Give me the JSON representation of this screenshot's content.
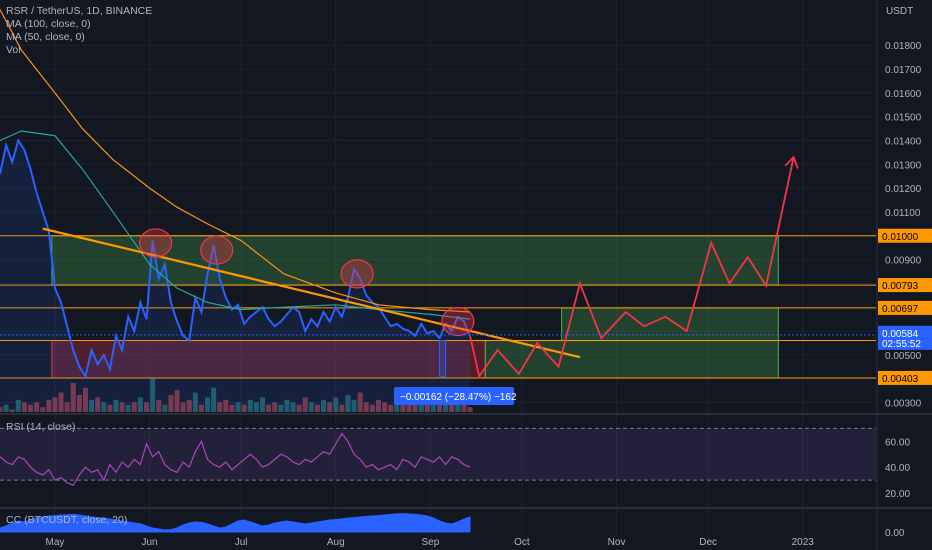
{
  "legend": {
    "title": "RSR / TetherUS, 1D, BINANCE",
    "ma100": "MA (100, close, 0)",
    "ma50": "MA (50, close, 0)",
    "vol": "Vol"
  },
  "rsi_label": "RSI (14, close)",
  "cc_label": "CC (BTCUSDT, close, 20)",
  "measure_label": "−0.00162 (−28.47%) −162",
  "price_current": "0.00584",
  "countdown": "02:55:52",
  "colors": {
    "background": "#131722",
    "price_line": "#2962ff",
    "ma100": "#f7931a",
    "ma50": "#26a69a",
    "trendline": "#ff9800",
    "projection": "#f23645",
    "green_zone": "#4caf50",
    "red_zone": "#f23645",
    "rsi_line": "#ab47bc",
    "cc_fill": "#2962ff"
  },
  "chart_data": {
    "type": "line",
    "symbol": "RSR / TetherUS",
    "interval": "1D",
    "exchange": "BINANCE",
    "y_axis_unit": "USDT",
    "yticks": [
      0.018,
      0.017,
      0.016,
      0.015,
      0.014,
      0.013,
      0.012,
      0.011,
      0.01,
      0.009,
      0.008,
      0.007,
      0.006,
      0.005,
      0.004,
      0.003
    ],
    "ytick_labels": [
      "0.01800",
      "0.01700",
      "0.01600",
      "0.01500",
      "0.01400",
      "0.01300",
      "0.01200",
      "0.01100",
      "0.01000",
      "0.00900",
      "0.00800",
      "0.00700",
      "0.00600",
      "0.00500",
      "0.00400",
      "0.00300"
    ],
    "ylim": [
      0.0026,
      0.0199
    ],
    "xticks": [
      {
        "label": "May",
        "date": "2022-05-01"
      },
      {
        "label": "Jun",
        "date": "2022-06-01"
      },
      {
        "label": "Jul",
        "date": "2022-07-01"
      },
      {
        "label": "Aug",
        "date": "2022-08-01"
      },
      {
        "label": "Sep",
        "date": "2022-09-01"
      },
      {
        "label": "Oct",
        "date": "2022-10-01"
      },
      {
        "label": "Nov",
        "date": "2022-11-01"
      },
      {
        "label": "Dec",
        "date": "2022-12-01"
      },
      {
        "label": "2023",
        "date": "2023-01-01"
      }
    ],
    "xlim": [
      "2022-04-13",
      "2023-01-25"
    ],
    "price_levels": [
      {
        "label": "0.01000",
        "value": 0.01
      },
      {
        "label": "0.00793",
        "value": 0.00793
      },
      {
        "label": "0.00697",
        "value": 0.00697
      },
      {
        "label": "0.00560",
        "value": 0.0056
      },
      {
        "label": "0.00403",
        "value": 0.00403
      }
    ],
    "current_price": 0.00584,
    "series": [
      {
        "name": "RSR / TetherUS",
        "x": [
          "2022-04-13",
          "2022-04-15",
          "2022-04-17",
          "2022-04-19",
          "2022-04-21",
          "2022-04-23",
          "2022-04-25",
          "2022-04-27",
          "2022-04-29",
          "2022-05-01",
          "2022-05-03",
          "2022-05-05",
          "2022-05-07",
          "2022-05-09",
          "2022-05-11",
          "2022-05-13",
          "2022-05-15",
          "2022-05-17",
          "2022-05-19",
          "2022-05-21",
          "2022-05-23",
          "2022-05-25",
          "2022-05-27",
          "2022-05-29",
          "2022-05-31",
          "2022-06-02",
          "2022-06-04",
          "2022-06-06",
          "2022-06-08",
          "2022-06-10",
          "2022-06-12",
          "2022-06-14",
          "2022-06-16",
          "2022-06-18",
          "2022-06-20",
          "2022-06-22",
          "2022-06-24",
          "2022-06-26",
          "2022-06-28",
          "2022-06-30",
          "2022-07-02",
          "2022-07-04",
          "2022-07-06",
          "2022-07-08",
          "2022-07-10",
          "2022-07-12",
          "2022-07-14",
          "2022-07-16",
          "2022-07-18",
          "2022-07-20",
          "2022-07-22",
          "2022-07-24",
          "2022-07-26",
          "2022-07-28",
          "2022-07-30",
          "2022-08-01",
          "2022-08-03",
          "2022-08-05",
          "2022-08-07",
          "2022-08-09",
          "2022-08-11",
          "2022-08-13",
          "2022-08-15",
          "2022-08-17",
          "2022-08-19",
          "2022-08-21",
          "2022-08-23",
          "2022-08-25",
          "2022-08-27",
          "2022-08-29",
          "2022-08-31",
          "2022-09-02",
          "2022-09-04",
          "2022-09-06",
          "2022-09-08",
          "2022-09-10",
          "2022-09-12",
          "2022-09-14"
        ],
        "values": [
          0.0126,
          0.0138,
          0.0131,
          0.014,
          0.0136,
          0.0128,
          0.0118,
          0.011,
          0.0102,
          0.0078,
          0.0072,
          0.0062,
          0.0052,
          0.0045,
          0.0041,
          0.0052,
          0.0046,
          0.005,
          0.0044,
          0.0058,
          0.0052,
          0.0066,
          0.006,
          0.0072,
          0.0065,
          0.0098,
          0.0082,
          0.0088,
          0.0072,
          0.0064,
          0.0058,
          0.0056,
          0.0074,
          0.0068,
          0.0084,
          0.0096,
          0.0082,
          0.0074,
          0.0069,
          0.0071,
          0.0063,
          0.0066,
          0.0068,
          0.007,
          0.0065,
          0.0062,
          0.0064,
          0.0067,
          0.007,
          0.0068,
          0.006,
          0.0065,
          0.0062,
          0.0068,
          0.0064,
          0.007,
          0.0066,
          0.0074,
          0.0086,
          0.0082,
          0.0075,
          0.0072,
          0.007,
          0.0066,
          0.0062,
          0.0063,
          0.0061,
          0.006,
          0.0058,
          0.0063,
          0.0059,
          0.006,
          0.0057,
          0.0063,
          0.006,
          0.0066,
          0.0064,
          0.0058
        ]
      },
      {
        "name": "MA (100, close, 0)",
        "x": [
          "2022-04-13",
          "2022-04-20",
          "2022-05-01",
          "2022-05-10",
          "2022-05-20",
          "2022-06-01",
          "2022-06-10",
          "2022-06-20",
          "2022-07-01",
          "2022-07-15",
          "2022-08-01",
          "2022-08-15",
          "2022-09-01",
          "2022-09-14"
        ],
        "values": [
          0.0195,
          0.0178,
          0.016,
          0.0145,
          0.0132,
          0.012,
          0.0112,
          0.0105,
          0.0098,
          0.0084,
          0.0076,
          0.0071,
          0.0069,
          0.0068
        ]
      },
      {
        "name": "MA (50, close, 0)",
        "x": [
          "2022-04-13",
          "2022-04-20",
          "2022-05-01",
          "2022-05-10",
          "2022-05-20",
          "2022-06-01",
          "2022-06-10",
          "2022-06-20",
          "2022-07-01",
          "2022-07-15",
          "2022-08-01",
          "2022-08-15",
          "2022-09-01",
          "2022-09-14"
        ],
        "values": [
          0.014,
          0.0144,
          0.0142,
          0.0128,
          0.011,
          0.0088,
          0.0078,
          0.0072,
          0.0069,
          0.007,
          0.0071,
          0.0069,
          0.0067,
          0.0065
        ]
      }
    ],
    "trendline": {
      "x": [
        "2022-04-27",
        "2022-10-20"
      ],
      "values": [
        0.0103,
        0.0049
      ]
    },
    "projection": {
      "x": [
        "2022-09-14",
        "2022-09-17",
        "2022-09-23",
        "2022-09-30",
        "2022-10-06",
        "2022-10-13",
        "2022-10-20",
        "2022-10-27",
        "2022-11-04",
        "2022-11-10",
        "2022-11-17",
        "2022-11-24",
        "2022-12-02",
        "2022-12-08",
        "2022-12-14",
        "2022-12-20",
        "2022-12-29"
      ],
      "values": [
        0.0058,
        0.0041,
        0.0052,
        0.0042,
        0.0055,
        0.0045,
        0.008,
        0.0057,
        0.0068,
        0.0062,
        0.0066,
        0.006,
        0.0097,
        0.008,
        0.0091,
        0.0079,
        0.0133
      ]
    },
    "zones": [
      {
        "type": "green",
        "x": [
          "2022-04-30",
          "2022-12-24"
        ],
        "y": [
          0.00793,
          0.01
        ]
      },
      {
        "type": "red",
        "x": [
          "2022-04-30",
          "2022-09-19"
        ],
        "y": [
          0.00403,
          0.0056
        ]
      },
      {
        "type": "green",
        "x": [
          "2022-09-19",
          "2022-12-24"
        ],
        "y": [
          0.00403,
          0.0056
        ]
      },
      {
        "type": "green",
        "x": [
          "2022-10-14",
          "2022-12-24"
        ],
        "y": [
          0.0056,
          0.00697
        ]
      }
    ],
    "highlights": [
      {
        "x": "2022-06-03",
        "y": 0.0097
      },
      {
        "x": "2022-06-23",
        "y": 0.0094
      },
      {
        "x": "2022-08-08",
        "y": 0.0084
      },
      {
        "x": "2022-09-10",
        "y": 0.0064
      }
    ],
    "measure": {
      "x": "2022-09-05",
      "y": [
        0.0056,
        0.0041
      ]
    },
    "volume": [
      2,
      3,
      1,
      5,
      4,
      3,
      4,
      2,
      5,
      6,
      8,
      4,
      12,
      7,
      10,
      5,
      6,
      4,
      3,
      5,
      4,
      3,
      4,
      6,
      4,
      14,
      5,
      3,
      7,
      9,
      4,
      5,
      8,
      3,
      6,
      10,
      4,
      5,
      3,
      4,
      3,
      5,
      4,
      6,
      3,
      4,
      3,
      5,
      4,
      3,
      6,
      4,
      3,
      5,
      4,
      6,
      3,
      7,
      5,
      8,
      4,
      3,
      5,
      4,
      3,
      6,
      3,
      4,
      3,
      5,
      4,
      3,
      4,
      8,
      3,
      5,
      4,
      2
    ],
    "rsi": {
      "name": "RSI (14, close)",
      "yticks": [
        60,
        40,
        20
      ],
      "ytick_labels": [
        "60.00",
        "40.00",
        "20.00"
      ],
      "bands": [
        70,
        30
      ],
      "ylim": [
        10,
        78
      ],
      "values": [
        48,
        44,
        42,
        48,
        46,
        40,
        36,
        34,
        38,
        30,
        32,
        28,
        26,
        34,
        40,
        36,
        38,
        30,
        42,
        36,
        44,
        40,
        46,
        42,
        58,
        48,
        52,
        42,
        38,
        36,
        44,
        40,
        52,
        60,
        46,
        42,
        40,
        44,
        38,
        42,
        46,
        50,
        46,
        40,
        42,
        46,
        50,
        48,
        44,
        42,
        46,
        44,
        48,
        52,
        50,
        58,
        66,
        60,
        50,
        46,
        40,
        42,
        38,
        40,
        42,
        38,
        46,
        44,
        40,
        48,
        46,
        44,
        48,
        42,
        48,
        46,
        42,
        40
      ]
    },
    "cc": {
      "name": "CC (BTCUSDT, close, 20)",
      "yticks": [
        0
      ],
      "ytick_labels": [
        "0.00"
      ],
      "ylim": [
        -0.2,
        1.1
      ],
      "values": [
        0.2,
        0.3,
        0.45,
        0.55,
        0.5,
        0.6,
        0.7,
        0.75,
        0.8,
        0.82,
        0.85,
        0.86,
        0.88,
        0.85,
        0.8,
        0.75,
        0.72,
        0.7,
        0.65,
        0.6,
        0.55,
        0.5,
        0.45,
        0.4,
        0.3,
        0.2,
        0.15,
        0.1,
        0.12,
        0.2,
        0.35,
        0.45,
        0.5,
        0.48,
        0.4,
        0.3,
        0.2,
        0.25,
        0.4,
        0.55,
        0.6,
        0.5,
        0.4,
        0.3,
        0.35,
        0.45,
        0.5,
        0.55,
        0.5,
        0.45,
        0.4,
        0.45,
        0.5,
        0.55,
        0.6,
        0.62,
        0.65,
        0.7,
        0.72,
        0.75,
        0.78,
        0.8,
        0.82,
        0.85,
        0.88,
        0.9,
        0.92,
        0.9,
        0.88,
        0.85,
        0.8,
        0.7,
        0.55,
        0.45,
        0.4,
        0.5,
        0.65,
        0.75
      ]
    }
  }
}
